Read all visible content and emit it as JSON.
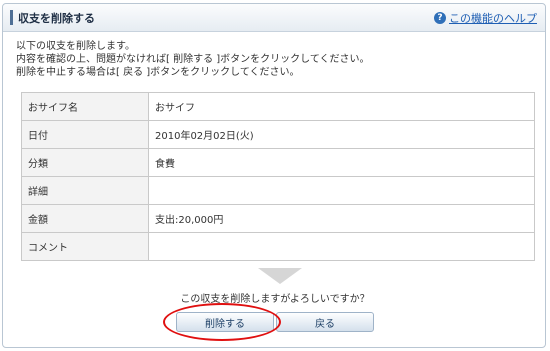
{
  "header": {
    "title": "収支を削除する",
    "help_label": "この機能のヘルプ",
    "help_icon": "question-icon"
  },
  "instructions": [
    "以下の収支を削除します。",
    "内容を確認の上、問題がなければ[ 削除する ]ボタンをクリックしてください。",
    "削除を中止する場合は[ 戻る ]ボタンをクリックしてください。"
  ],
  "details": {
    "rows": [
      {
        "label": "おサイフ名",
        "value": "おサイフ"
      },
      {
        "label": "日付",
        "value": "2010年02月02日(火)"
      },
      {
        "label": "分類",
        "value": "食費"
      },
      {
        "label": "詳細",
        "value": ""
      },
      {
        "label": "金額",
        "value": "支出:20,000円"
      },
      {
        "label": "コメント",
        "value": ""
      }
    ]
  },
  "confirm_text": "この収支を削除しますがよろしいですか？",
  "buttons": {
    "delete_label": "削除する",
    "back_label": "戻る"
  },
  "colors": {
    "accent": "#4f6f95",
    "link": "#1f5fb4",
    "highlight": "#e01010"
  }
}
